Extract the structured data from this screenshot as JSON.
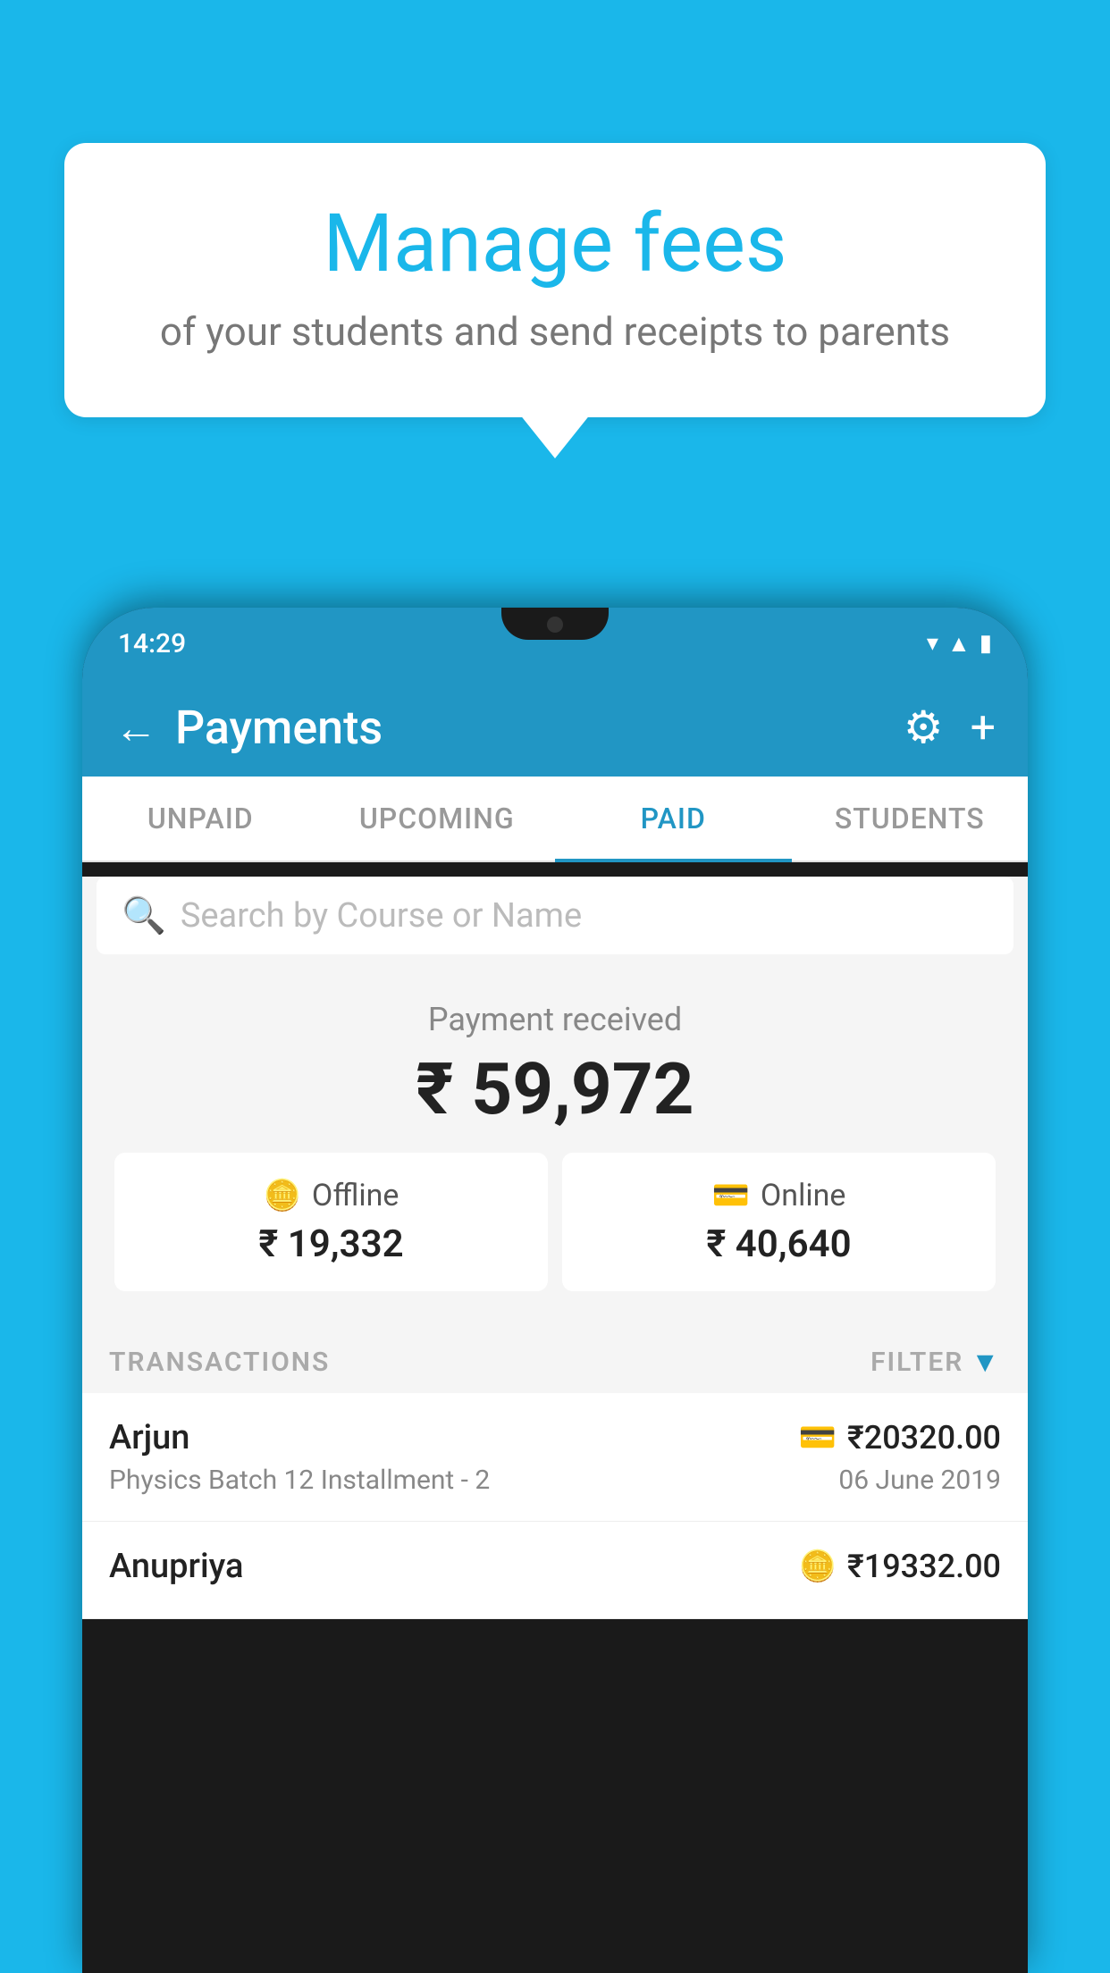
{
  "bubble": {
    "heading": "Manage fees",
    "subtext": "of your students and send receipts to parents"
  },
  "status_bar": {
    "time": "14:29"
  },
  "header": {
    "title": "Payments",
    "back_label": "←",
    "settings_icon": "⚙",
    "add_icon": "+"
  },
  "tabs": [
    {
      "label": "UNPAID",
      "active": false
    },
    {
      "label": "UPCOMING",
      "active": false
    },
    {
      "label": "PAID",
      "active": true
    },
    {
      "label": "STUDENTS",
      "active": false
    }
  ],
  "search": {
    "placeholder": "Search by Course or Name"
  },
  "payment_summary": {
    "label": "Payment received",
    "amount": "₹ 59,972"
  },
  "payment_cards": [
    {
      "icon": "💳",
      "label": "Offline",
      "amount": "₹ 19,332"
    },
    {
      "icon": "💳",
      "label": "Online",
      "amount": "₹ 40,640"
    }
  ],
  "transactions_section": {
    "label": "TRANSACTIONS",
    "filter_label": "FILTER"
  },
  "transactions": [
    {
      "name": "Arjun",
      "course": "Physics Batch 12 Installment - 2",
      "amount": "₹20320.00",
      "date": "06 June 2019",
      "type": "online"
    },
    {
      "name": "Anupriya",
      "course": "",
      "amount": "₹19332.00",
      "date": "",
      "type": "offline"
    }
  ],
  "colors": {
    "primary": "#2196c4",
    "background": "#1ab7ea",
    "white": "#ffffff",
    "gray_bg": "#f5f5f5"
  }
}
